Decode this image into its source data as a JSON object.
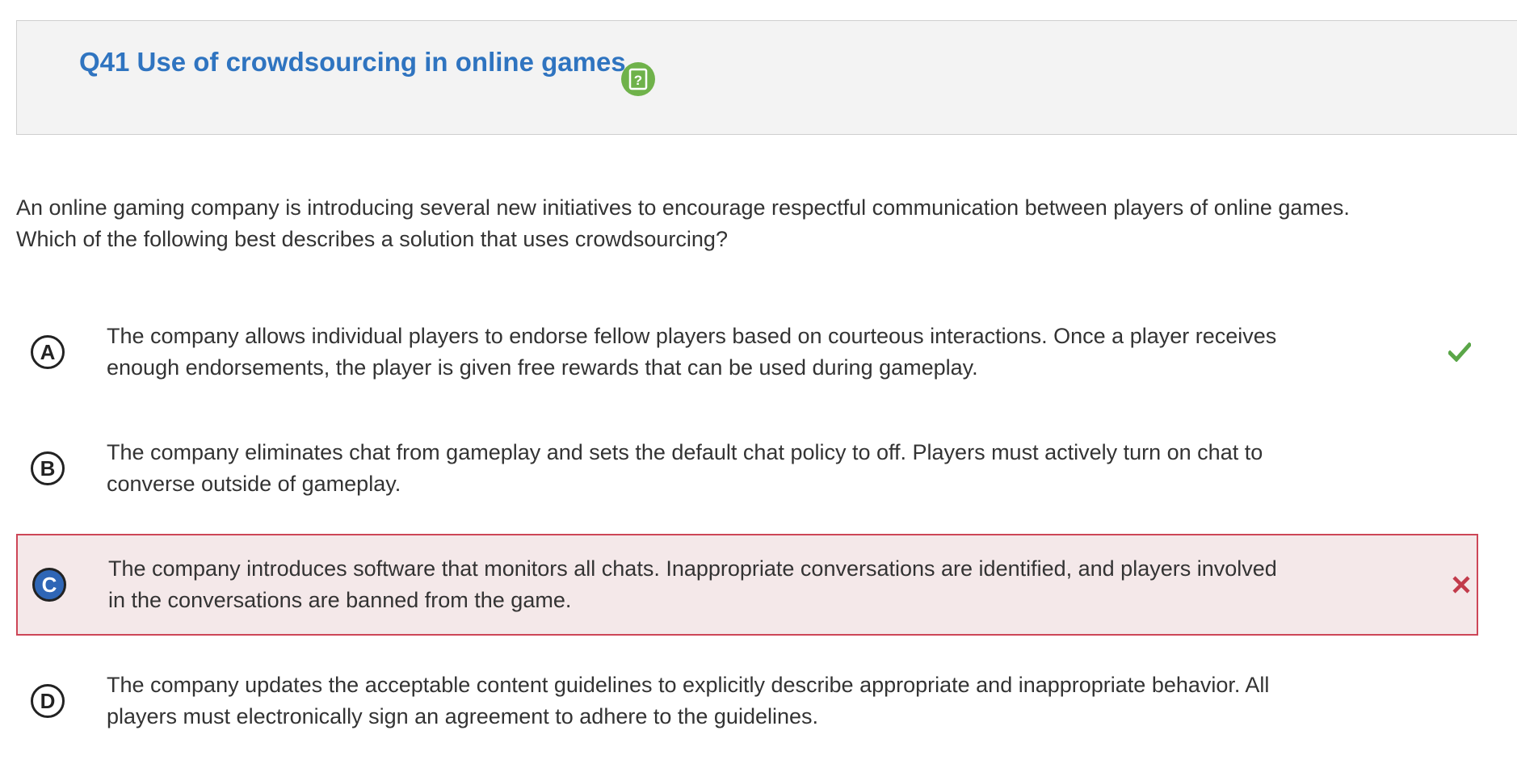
{
  "question": {
    "title": "Q41 Use of crowdsourcing in online games",
    "help_icon": "help-question-icon",
    "prompt": "An online gaming company is introducing several new initiatives to encourage respectful communication between players of online games.\nWhich of the following best describes a solution that uses crowdsourcing?"
  },
  "options": [
    {
      "letter": "A",
      "text": "The company allows individual players to endorse fellow players based on courteous interactions. Once a player receives enough endorsements, the player is given free rewards that can be used during gameplay.",
      "status": "correct"
    },
    {
      "letter": "B",
      "text": "The company eliminates chat from gameplay and sets the default chat policy to off. Players must actively turn on chat to converse outside of gameplay.",
      "status": "none"
    },
    {
      "letter": "C",
      "text": "The company introduces software that monitors all chats. Inappropriate conversations are identified, and players involved in the conversations are banned from the game.",
      "status": "selected-incorrect"
    },
    {
      "letter": "D",
      "text": "The company updates the acceptable content guidelines to explicitly describe appropriate and inappropriate behavior. All players must electronically sign an agreement to adhere to the guidelines.",
      "status": "none"
    }
  ],
  "colors": {
    "title_blue": "#2f74c0",
    "help_green": "#6fb24a",
    "correct_green": "#5aa648",
    "incorrect_red": "#c23b4b",
    "selected_fill": "#2f66b6",
    "wrong_bg": "#f4e8e9"
  }
}
